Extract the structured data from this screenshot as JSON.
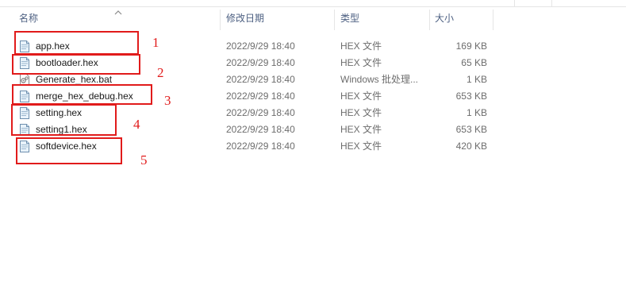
{
  "columns": {
    "name": "名称",
    "date": "修改日期",
    "type": "类型",
    "size": "大小"
  },
  "files": [
    {
      "name": "app.hex",
      "date": "2022/9/29 18:40",
      "type": "HEX 文件",
      "size": "169 KB",
      "icon": "hex-file-icon"
    },
    {
      "name": "bootloader.hex",
      "date": "2022/9/29 18:40",
      "type": "HEX 文件",
      "size": "65 KB",
      "icon": "hex-file-icon"
    },
    {
      "name": "Generate_hex.bat",
      "date": "2022/9/29 18:40",
      "type": "Windows 批处理...",
      "size": "1 KB",
      "icon": "batch-file-icon"
    },
    {
      "name": "merge_hex_debug.hex",
      "date": "2022/9/29 18:40",
      "type": "HEX 文件",
      "size": "653 KB",
      "icon": "hex-file-icon"
    },
    {
      "name": "setting.hex",
      "date": "2022/9/29 18:40",
      "type": "HEX 文件",
      "size": "1 KB",
      "icon": "hex-file-icon"
    },
    {
      "name": "setting1.hex",
      "date": "2022/9/29 18:40",
      "type": "HEX 文件",
      "size": "653 KB",
      "icon": "hex-file-icon"
    },
    {
      "name": "softdevice.hex",
      "date": "2022/9/29 18:40",
      "type": "HEX 文件",
      "size": "420 KB",
      "icon": "hex-file-icon"
    }
  ],
  "annotations": [
    "1",
    "2",
    "3",
    "4",
    "5"
  ],
  "colors": {
    "annotation": "#e11b1b",
    "header_text": "#4d6082",
    "detail_text": "#6d6d6d"
  }
}
